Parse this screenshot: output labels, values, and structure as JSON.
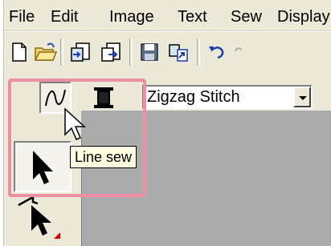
{
  "menubar": {
    "items": [
      {
        "label": "File"
      },
      {
        "label": "Edit"
      },
      {
        "label": "Image"
      },
      {
        "label": "Text"
      },
      {
        "label": "Sew"
      },
      {
        "label": "Display"
      }
    ]
  },
  "toolbar": {
    "buttons": [
      {
        "icon": "new-icon"
      },
      {
        "icon": "open-folder-icon"
      },
      {
        "icon": "import-icon"
      },
      {
        "icon": "export-icon"
      },
      {
        "icon": "save-icon"
      },
      {
        "icon": "send-icon"
      },
      {
        "icon": "undo-icon"
      },
      {
        "icon": "redo-icon"
      }
    ]
  },
  "sew_toolbar": {
    "line_sew_icon": "line-sew-icon",
    "color_icon": "thread-spool-icon",
    "stitch_select": {
      "value": "Zigzag Stitch"
    }
  },
  "tooltip": {
    "text": "Line sew"
  },
  "palette": {
    "tools": [
      {
        "icon": "select-arrow-icon"
      },
      {
        "icon": "point-edit-icon"
      }
    ]
  },
  "colors": {
    "highlight": "#ef8fa6",
    "workspace": "#ababab",
    "chrome": "#ece9d8",
    "tooltip_bg": "#ffffe1"
  }
}
